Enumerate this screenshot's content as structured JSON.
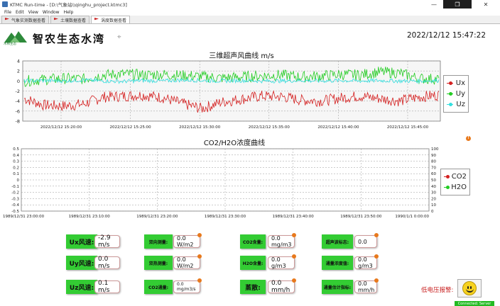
{
  "window": {
    "title": "KTMC Run-time - [D:\\气象站\\\\qinghu_project.ktmc3]",
    "min_glyph": "—",
    "max_glyph": "❐",
    "close_glyph": "✕"
  },
  "menu": [
    "File",
    "Edit",
    "View",
    "Window",
    "Help"
  ],
  "tabs": [
    {
      "label": "气象实测数据查看",
      "active": false
    },
    {
      "label": "土壤数据查看",
      "active": false
    },
    {
      "label": "涡度数据查看",
      "active": true
    }
  ],
  "header": {
    "logo_text": "木棉生态",
    "brand": "智农生态水湾",
    "datetime": "2022/12/12 15:47:22"
  },
  "chart_data": [
    {
      "type": "line",
      "title": "三维超声风曲线 m/s",
      "x_ticks": [
        "2022/12/12 15:20:00",
        "2022/12/12 15:25:00",
        "2022/12/12 15:30:00",
        "2022/12/12 15:35:00",
        "2022/12/12 15:40:00",
        "2022/12/12 15:45:00"
      ],
      "ylim": [
        -8,
        4
      ],
      "y_ticks": [
        4,
        2,
        0,
        -2,
        -4,
        -6,
        -8
      ],
      "grid": true,
      "legend_position": "right",
      "series": [
        {
          "name": "Ux",
          "color": "#d42020",
          "mean": -3.6,
          "amplitude": 1.4,
          "values_approx": [
            -3.5,
            -4.8,
            -5.0,
            -4.6,
            -3.2,
            -3.0,
            -2.8,
            -3.3,
            -4.5,
            -5.5,
            -4.2,
            -3.6,
            -3.0,
            -3.1,
            -3.8,
            -4.0,
            -3.4,
            -3.0,
            -3.5,
            -4.0,
            -3.2,
            -2.8
          ]
        },
        {
          "name": "Uy",
          "color": "#22cc22",
          "mean": 0.7,
          "amplitude": 1.4,
          "values_approx": [
            0.0,
            0.3,
            0.5,
            0.4,
            1.2,
            1.4,
            1.2,
            1.3,
            1.1,
            0.9,
            0.6,
            0.8,
            1.0,
            1.2,
            0.8,
            1.0,
            1.3,
            1.2,
            1.8,
            1.6,
            0.5,
            0.4
          ]
        },
        {
          "name": "Uz",
          "color": "#33e0e0",
          "mean": 0.0,
          "amplitude": 0.5,
          "values_approx": [
            0.0,
            0.1,
            0.0,
            0.2,
            0.0,
            -0.1,
            0.1,
            0.0,
            0.2,
            0.1,
            0.0,
            0.1,
            0.0,
            0.0,
            0.1,
            0.0,
            0.1,
            0.0,
            0.1,
            0.0,
            0.0,
            0.1
          ]
        }
      ]
    },
    {
      "type": "line",
      "title": "CO2/H2O浓度曲线",
      "x_ticks": [
        "1989/12/31 23:00:00",
        "1989/12/31 23:10:00",
        "1989/12/31 23:20:00",
        "1989/12/31 23:30:00",
        "1989/12/31 23:40:00",
        "1989/12/31 23:50:00",
        "1990/1/1 0:00:00"
      ],
      "ylim_left": [
        -0.5,
        0.5
      ],
      "y_ticks_left": [
        "0.5",
        "0.4",
        "0.3",
        "0.2",
        "0.1",
        "0",
        "-0.1",
        "-0.2",
        "-0.3",
        "-0.4",
        "-0.5"
      ],
      "ylim_right": [
        0,
        100
      ],
      "y_ticks_right": [
        "100",
        "90",
        "80",
        "70",
        "60",
        "50",
        "40",
        "30",
        "20",
        "10",
        "0"
      ],
      "grid": true,
      "legend_position": "right",
      "series": [
        {
          "name": "CO2",
          "color": "#d42020",
          "values": []
        },
        {
          "name": "H2O",
          "color": "#22cc22",
          "values": []
        }
      ]
    }
  ],
  "metrics": [
    {
      "label": "Ux风速:",
      "value": "-2.9 m/s",
      "style": "big"
    },
    {
      "label": "双向测量:",
      "value": "0.0 W/m2",
      "style": "small"
    },
    {
      "label": "CO2含量:",
      "value": "0.0 mg/m3",
      "style": "small"
    },
    {
      "label": "超声波标志:",
      "value": "0.0",
      "style": "small"
    },
    {
      "label": "Uy风速:",
      "value": "0.0 m/s",
      "style": "big"
    },
    {
      "label": "双热测量:",
      "value": "0.0 W/m2",
      "style": "small"
    },
    {
      "label": "H2O含量:",
      "value": "0.0 g/m3",
      "style": "small"
    },
    {
      "label": "通量浓度值:",
      "value": "0.0 g/m3",
      "style": "small"
    },
    {
      "label": "Uz风速:",
      "value": "0.1 m/s",
      "style": "big"
    },
    {
      "label": "CO2通量:",
      "value": "0.0 mg/m3/s",
      "style": "small"
    },
    {
      "label": "蒸散:",
      "value": "0.0 mm/h",
      "style": "big"
    },
    {
      "label": "通量估计指标:",
      "value": "0.0 mm/h",
      "style": "small"
    }
  ],
  "alarm": {
    "label": "低电压报警:",
    "state": "ok"
  },
  "status": {
    "text": "Connected: Server"
  }
}
